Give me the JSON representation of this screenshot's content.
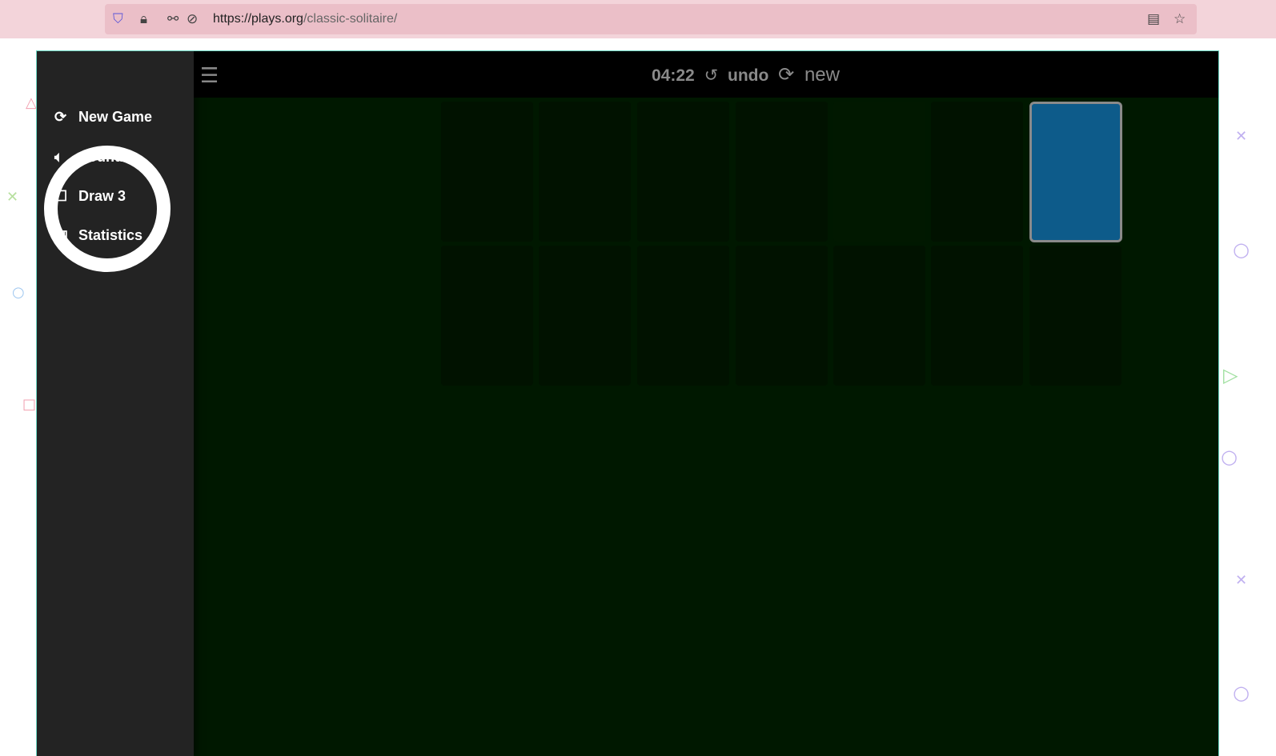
{
  "browser": {
    "url_host": "https://plays.org",
    "url_path": "/classic-solitaire/"
  },
  "sidebar": {
    "items": [
      {
        "label": "New Game",
        "icon": "refresh-icon"
      },
      {
        "label": "Sound",
        "icon": "speaker-icon"
      },
      {
        "label": "Draw 3",
        "icon": "checkbox-icon"
      },
      {
        "label": "Statistics",
        "icon": "bar-chart-icon"
      }
    ]
  },
  "header": {
    "timer": "04:22",
    "undo": "undo",
    "new": "new"
  },
  "colors": {
    "felt": "#001800",
    "card_back": "#0d5b8a",
    "sidebar": "#232323"
  }
}
